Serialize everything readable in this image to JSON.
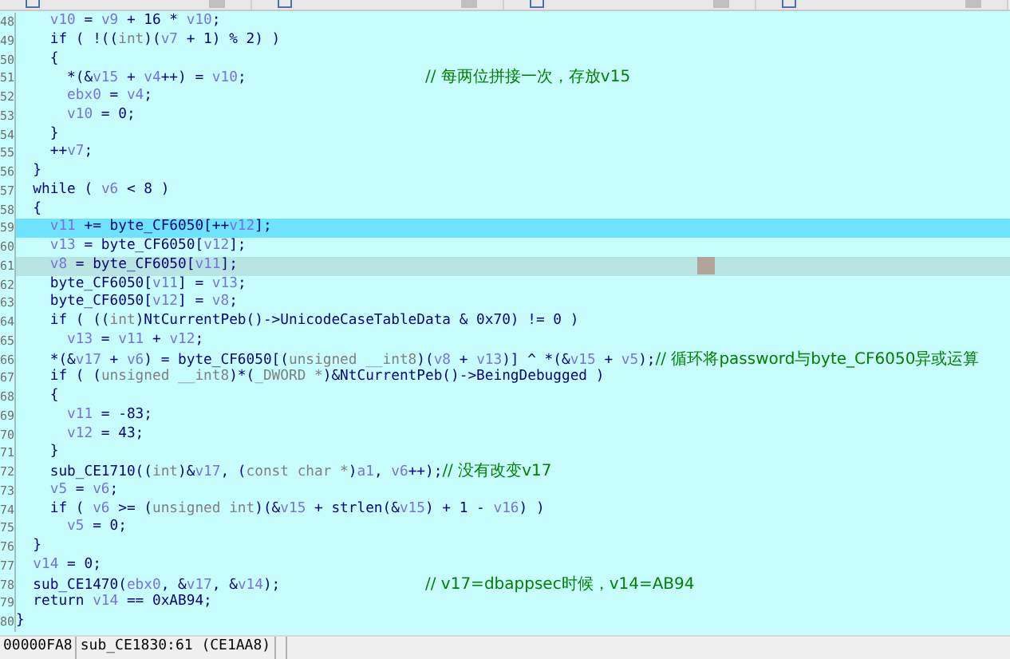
{
  "lines": [
    {
      "number": "48",
      "selected": false,
      "cursor_line": false,
      "segments": [
        {
          "kind": "var",
          "text": "    v10"
        },
        {
          "kind": "code",
          "text": " = "
        },
        {
          "kind": "var",
          "text": "v9"
        },
        {
          "kind": "code",
          "text": " + 16 * "
        },
        {
          "kind": "var",
          "text": "v10"
        },
        {
          "kind": "code",
          "text": ";"
        }
      ]
    },
    {
      "number": "49",
      "selected": false,
      "cursor_line": false,
      "segments": [
        {
          "kind": "code",
          "text": "    if ( !(("
        },
        {
          "kind": "type",
          "text": "int"
        },
        {
          "kind": "code",
          "text": ")("
        },
        {
          "kind": "var",
          "text": "v7"
        },
        {
          "kind": "code",
          "text": " + 1) % 2) )"
        }
      ]
    },
    {
      "number": "50",
      "selected": false,
      "cursor_line": false,
      "segments": [
        {
          "kind": "code",
          "text": "    {"
        }
      ]
    },
    {
      "number": "51",
      "selected": false,
      "cursor_line": false,
      "segments": [
        {
          "kind": "code",
          "text": "      *(&"
        },
        {
          "kind": "var",
          "text": "v15"
        },
        {
          "kind": "code",
          "text": " + "
        },
        {
          "kind": "var",
          "text": "v4"
        },
        {
          "kind": "code",
          "text": "++) = "
        },
        {
          "kind": "var",
          "text": "v10"
        },
        {
          "kind": "code",
          "text": ";                     "
        },
        {
          "kind": "comment",
          "text": "// 每两位拼接一次，存放v15"
        }
      ]
    },
    {
      "number": "52",
      "selected": false,
      "cursor_line": false,
      "segments": [
        {
          "kind": "var",
          "text": "      ebx0"
        },
        {
          "kind": "code",
          "text": " = "
        },
        {
          "kind": "var",
          "text": "v4"
        },
        {
          "kind": "code",
          "text": ";"
        }
      ]
    },
    {
      "number": "53",
      "selected": false,
      "cursor_line": false,
      "segments": [
        {
          "kind": "var",
          "text": "      v10"
        },
        {
          "kind": "code",
          "text": " = 0;"
        }
      ]
    },
    {
      "number": "54",
      "selected": false,
      "cursor_line": false,
      "segments": [
        {
          "kind": "code",
          "text": "    }"
        }
      ]
    },
    {
      "number": "55",
      "selected": false,
      "cursor_line": false,
      "segments": [
        {
          "kind": "code",
          "text": "    ++"
        },
        {
          "kind": "var",
          "text": "v7"
        },
        {
          "kind": "code",
          "text": ";"
        }
      ]
    },
    {
      "number": "56",
      "selected": false,
      "cursor_line": false,
      "segments": [
        {
          "kind": "code",
          "text": "  }"
        }
      ]
    },
    {
      "number": "57",
      "selected": false,
      "cursor_line": false,
      "segments": [
        {
          "kind": "code",
          "text": "  while ( "
        },
        {
          "kind": "var",
          "text": "v6"
        },
        {
          "kind": "code",
          "text": " < 8 )"
        }
      ]
    },
    {
      "number": "58",
      "selected": false,
      "cursor_line": false,
      "segments": [
        {
          "kind": "code",
          "text": "  {"
        }
      ]
    },
    {
      "number": "59",
      "selected": true,
      "cursor_line": false,
      "segments": [
        {
          "kind": "var",
          "text": "    v11"
        },
        {
          "kind": "code",
          "text": " += byte_CF6050[++"
        },
        {
          "kind": "var",
          "text": "v12"
        },
        {
          "kind": "code",
          "text": "];"
        }
      ]
    },
    {
      "number": "60",
      "selected": false,
      "cursor_line": false,
      "segments": [
        {
          "kind": "var",
          "text": "    v13"
        },
        {
          "kind": "code",
          "text": " = byte_CF6050["
        },
        {
          "kind": "var",
          "text": "v12"
        },
        {
          "kind": "code",
          "text": "];"
        }
      ]
    },
    {
      "number": "61",
      "selected": false,
      "cursor_line": true,
      "segments": [
        {
          "kind": "var",
          "text": "    v8"
        },
        {
          "kind": "code",
          "text": " = byte_CF6050["
        },
        {
          "kind": "var",
          "text": "v11"
        },
        {
          "kind": "code",
          "text": "];"
        }
      ]
    },
    {
      "number": "62",
      "selected": false,
      "cursor_line": false,
      "segments": [
        {
          "kind": "code",
          "text": "    byte_CF6050["
        },
        {
          "kind": "var",
          "text": "v11"
        },
        {
          "kind": "code",
          "text": "] = "
        },
        {
          "kind": "var",
          "text": "v13"
        },
        {
          "kind": "code",
          "text": ";"
        }
      ]
    },
    {
      "number": "63",
      "selected": false,
      "cursor_line": false,
      "segments": [
        {
          "kind": "code",
          "text": "    byte_CF6050["
        },
        {
          "kind": "var",
          "text": "v12"
        },
        {
          "kind": "code",
          "text": "] = "
        },
        {
          "kind": "var",
          "text": "v8"
        },
        {
          "kind": "code",
          "text": ";"
        }
      ]
    },
    {
      "number": "64",
      "selected": false,
      "cursor_line": false,
      "segments": [
        {
          "kind": "code",
          "text": "    if ( (("
        },
        {
          "kind": "type",
          "text": "int"
        },
        {
          "kind": "code",
          "text": ")NtCurrentPeb()->UnicodeCaseTableData & 0x70) != 0 )"
        }
      ]
    },
    {
      "number": "65",
      "selected": false,
      "cursor_line": false,
      "segments": [
        {
          "kind": "var",
          "text": "      v13"
        },
        {
          "kind": "code",
          "text": " = "
        },
        {
          "kind": "var",
          "text": "v11"
        },
        {
          "kind": "code",
          "text": " + "
        },
        {
          "kind": "var",
          "text": "v12"
        },
        {
          "kind": "code",
          "text": ";"
        }
      ]
    },
    {
      "number": "66",
      "selected": false,
      "cursor_line": false,
      "segments": [
        {
          "kind": "code",
          "text": "    *(&"
        },
        {
          "kind": "var",
          "text": "v17"
        },
        {
          "kind": "code",
          "text": " + "
        },
        {
          "kind": "var",
          "text": "v6"
        },
        {
          "kind": "code",
          "text": ") = byte_CF6050[("
        },
        {
          "kind": "type",
          "text": "unsigned __int8"
        },
        {
          "kind": "code",
          "text": ")("
        },
        {
          "kind": "var",
          "text": "v8"
        },
        {
          "kind": "code",
          "text": " + "
        },
        {
          "kind": "var",
          "text": "v13"
        },
        {
          "kind": "code",
          "text": ")] ^ *(&"
        },
        {
          "kind": "var",
          "text": "v15"
        },
        {
          "kind": "code",
          "text": " + "
        },
        {
          "kind": "var",
          "text": "v5"
        },
        {
          "kind": "code",
          "text": ");"
        },
        {
          "kind": "comment",
          "text": "// 循环将password与byte_CF6050异或运算"
        }
      ]
    },
    {
      "number": "67",
      "selected": false,
      "cursor_line": false,
      "segments": [
        {
          "kind": "code",
          "text": "    if ( ("
        },
        {
          "kind": "type",
          "text": "unsigned __int8"
        },
        {
          "kind": "code",
          "text": ")*("
        },
        {
          "kind": "type",
          "text": "_DWORD *"
        },
        {
          "kind": "code",
          "text": ")&NtCurrentPeb()->BeingDebugged )"
        }
      ]
    },
    {
      "number": "68",
      "selected": false,
      "cursor_line": false,
      "segments": [
        {
          "kind": "code",
          "text": "    {"
        }
      ]
    },
    {
      "number": "69",
      "selected": false,
      "cursor_line": false,
      "segments": [
        {
          "kind": "var",
          "text": "      v11"
        },
        {
          "kind": "code",
          "text": " = -83;"
        }
      ]
    },
    {
      "number": "70",
      "selected": false,
      "cursor_line": false,
      "segments": [
        {
          "kind": "var",
          "text": "      v12"
        },
        {
          "kind": "code",
          "text": " = 43;"
        }
      ]
    },
    {
      "number": "71",
      "selected": false,
      "cursor_line": false,
      "segments": [
        {
          "kind": "code",
          "text": "    }"
        }
      ]
    },
    {
      "number": "72",
      "selected": false,
      "cursor_line": false,
      "segments": [
        {
          "kind": "code",
          "text": "    sub_CE1710(("
        },
        {
          "kind": "type",
          "text": "int"
        },
        {
          "kind": "code",
          "text": ")&"
        },
        {
          "kind": "var",
          "text": "v17"
        },
        {
          "kind": "code",
          "text": ", ("
        },
        {
          "kind": "type",
          "text": "const char *"
        },
        {
          "kind": "code",
          "text": ")"
        },
        {
          "kind": "var",
          "text": "a1"
        },
        {
          "kind": "code",
          "text": ", "
        },
        {
          "kind": "var",
          "text": "v6"
        },
        {
          "kind": "code",
          "text": "++);"
        },
        {
          "kind": "comment",
          "text": "// 没有改变v17"
        }
      ]
    },
    {
      "number": "73",
      "selected": false,
      "cursor_line": false,
      "segments": [
        {
          "kind": "var",
          "text": "    v5"
        },
        {
          "kind": "code",
          "text": " = "
        },
        {
          "kind": "var",
          "text": "v6"
        },
        {
          "kind": "code",
          "text": ";"
        }
      ]
    },
    {
      "number": "74",
      "selected": false,
      "cursor_line": false,
      "segments": [
        {
          "kind": "code",
          "text": "    if ( "
        },
        {
          "kind": "var",
          "text": "v6"
        },
        {
          "kind": "code",
          "text": " >= ("
        },
        {
          "kind": "type",
          "text": "unsigned int"
        },
        {
          "kind": "code",
          "text": ")(&"
        },
        {
          "kind": "var",
          "text": "v15"
        },
        {
          "kind": "code",
          "text": " + strlen(&"
        },
        {
          "kind": "var",
          "text": "v15"
        },
        {
          "kind": "code",
          "text": ") + 1 - "
        },
        {
          "kind": "var",
          "text": "v16"
        },
        {
          "kind": "code",
          "text": ") )"
        }
      ]
    },
    {
      "number": "75",
      "selected": false,
      "cursor_line": false,
      "segments": [
        {
          "kind": "var",
          "text": "      v5"
        },
        {
          "kind": "code",
          "text": " = 0;"
        }
      ]
    },
    {
      "number": "76",
      "selected": false,
      "cursor_line": false,
      "segments": [
        {
          "kind": "code",
          "text": "  }"
        }
      ]
    },
    {
      "number": "77",
      "selected": false,
      "cursor_line": false,
      "segments": [
        {
          "kind": "var",
          "text": "  v14"
        },
        {
          "kind": "code",
          "text": " = 0;"
        }
      ]
    },
    {
      "number": "78",
      "selected": false,
      "cursor_line": false,
      "segments": [
        {
          "kind": "code",
          "text": "  sub_CE1470("
        },
        {
          "kind": "var",
          "text": "ebx0"
        },
        {
          "kind": "code",
          "text": ", &"
        },
        {
          "kind": "var",
          "text": "v17"
        },
        {
          "kind": "code",
          "text": ", &"
        },
        {
          "kind": "var",
          "text": "v14"
        },
        {
          "kind": "code",
          "text": ");                 "
        },
        {
          "kind": "comment",
          "text": "// v17=dbappsec时候，v14=AB94"
        }
      ]
    },
    {
      "number": "79",
      "selected": false,
      "cursor_line": false,
      "segments": [
        {
          "kind": "code",
          "text": "  return "
        },
        {
          "kind": "var",
          "text": "v14"
        },
        {
          "kind": "code",
          "text": " == 0xAB94;"
        }
      ]
    },
    {
      "number": "80",
      "selected": false,
      "cursor_line": false,
      "segments": [
        {
          "kind": "code",
          "text": "}"
        }
      ]
    }
  ],
  "status_bar": {
    "address": "00000FA8",
    "location": "sub_CE1830:61 (CE1AA8)"
  }
}
